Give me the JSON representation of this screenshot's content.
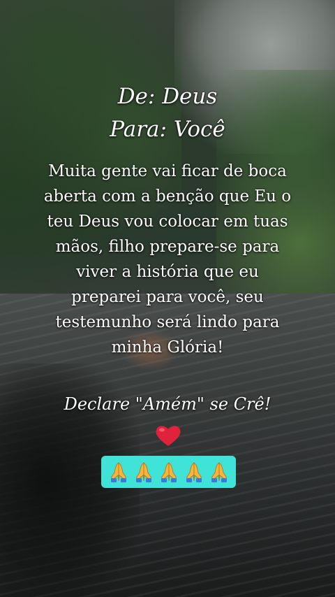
{
  "greeting": {
    "from": "De: Deus",
    "to": "Para: Você"
  },
  "message_lines": [
    "Muita gente vai ficar de boca",
    "aberta com a benção que Eu o",
    "teu Deus vou colocar em tuas",
    "mãos, filho prepare-se para",
    "viver a história que eu",
    "preparei para você, seu",
    "testemunho será lindo para",
    "minha Glória!"
  ],
  "declare": "Declare  \"Amém\" se Crê!",
  "icons": {
    "heart": "red-heart-icon",
    "prayer": "praying-hands-icon",
    "prayer_count": 5
  },
  "colors": {
    "text": "#ffffff",
    "heart": "#e0223a",
    "prayer_box": "#3fe3d7",
    "hands": "#f4b63f"
  }
}
